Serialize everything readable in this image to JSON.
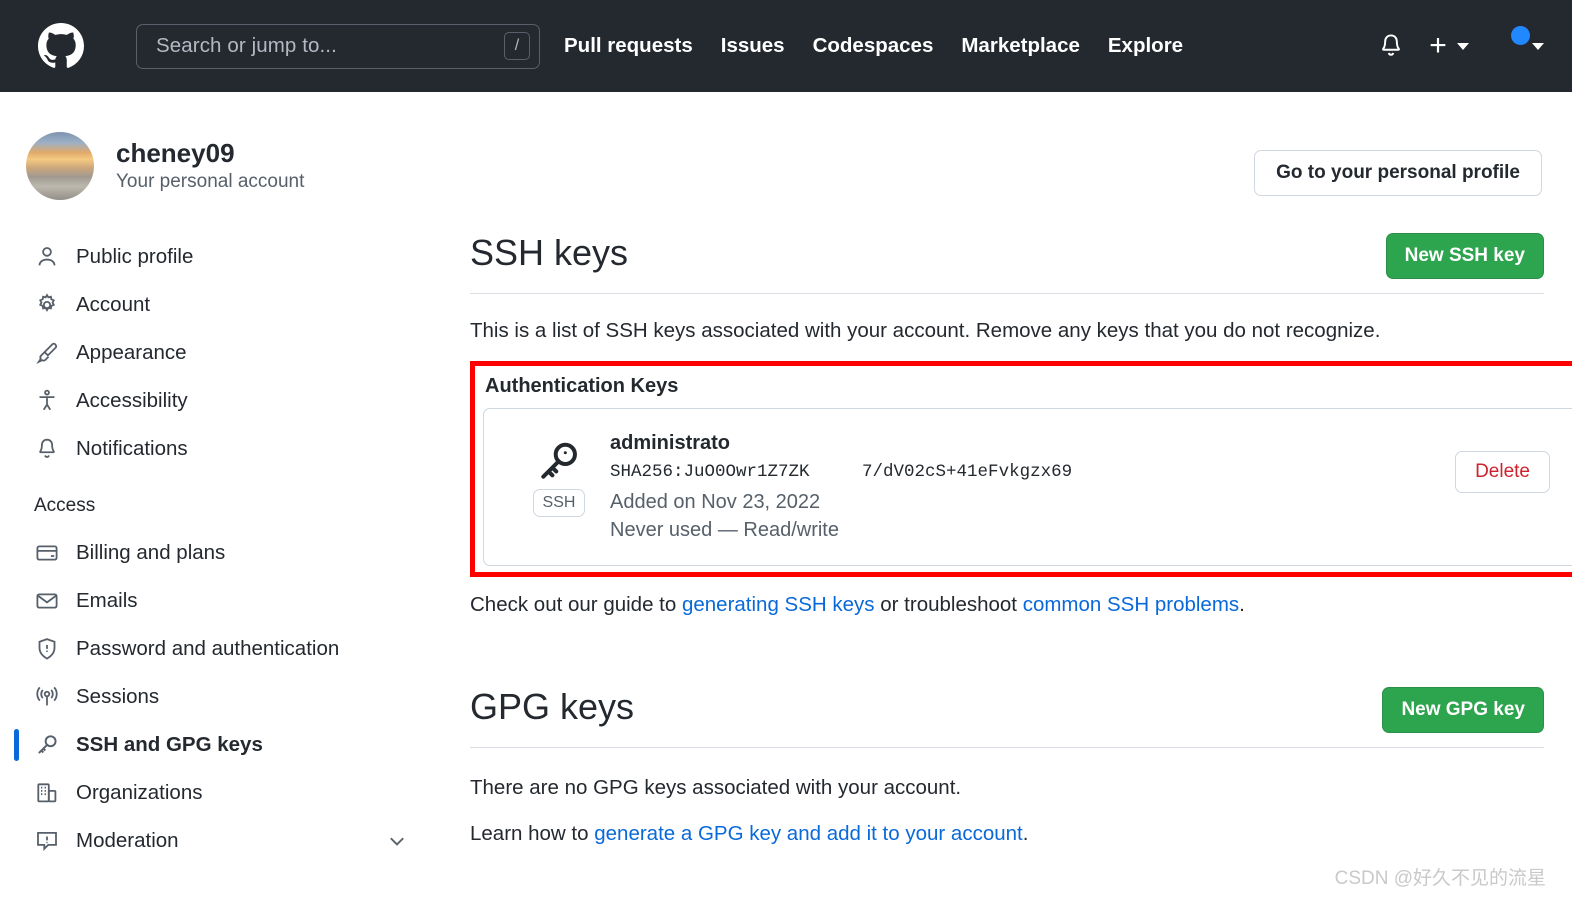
{
  "header": {
    "logo_icon": "github-mark-icon",
    "search": {
      "placeholder": "Search or jump to...",
      "shortcut": "/"
    },
    "nav": [
      {
        "label": "Pull requests"
      },
      {
        "label": "Issues"
      },
      {
        "label": "Codespaces"
      },
      {
        "label": "Marketplace"
      },
      {
        "label": "Explore"
      }
    ],
    "notifications_icon": "bell-icon",
    "create_new_icon": "plus-icon",
    "create_new_caret": "chevron-down-icon",
    "avatar_icon": "user-avatar",
    "avatar_caret": "chevron-down-icon",
    "background_color": "#24292f"
  },
  "profile": {
    "name": "cheney09",
    "subtitle": "Your personal account",
    "go_to_profile_label": "Go to your personal profile"
  },
  "sidebar": {
    "items": [
      {
        "label": "Public profile",
        "icon": "person-icon",
        "active": false
      },
      {
        "label": "Account",
        "icon": "gear-icon",
        "active": false
      },
      {
        "label": "Appearance",
        "icon": "paintbrush-icon",
        "active": false
      },
      {
        "label": "Accessibility",
        "icon": "accessibility-icon",
        "active": false
      },
      {
        "label": "Notifications",
        "icon": "bell-icon",
        "active": false
      }
    ],
    "access_group_title": "Access",
    "access_items": [
      {
        "label": "Billing and plans",
        "icon": "credit-card-icon",
        "active": false
      },
      {
        "label": "Emails",
        "icon": "mail-icon",
        "active": false
      },
      {
        "label": "Password and authentication",
        "icon": "shield-lock-icon",
        "active": false
      },
      {
        "label": "Sessions",
        "icon": "broadcast-icon",
        "active": false
      },
      {
        "label": "SSH and GPG keys",
        "icon": "key-icon",
        "active": true
      },
      {
        "label": "Organizations",
        "icon": "organization-icon",
        "active": false
      },
      {
        "label": "Moderation",
        "icon": "report-icon",
        "active": false,
        "expandable": true
      }
    ]
  },
  "ssh_section": {
    "title": "SSH keys",
    "new_key_button": "New SSH key",
    "description": "This is a list of SSH keys associated with your account. Remove any keys that you do not recognize.",
    "subsection_title": "Authentication Keys",
    "key": {
      "icon": "key-icon",
      "badge": "SSH",
      "title": "administrato",
      "fingerprint": "SHA256:JuO0Owr1Z7ZK     7/dV02cS+41eFvkgzx69",
      "added": "Added on Nov 23, 2022",
      "usage": "Never used — Read/write",
      "delete_label": "Delete"
    },
    "help_prefix": "Check out our guide to ",
    "help_link1": "generating SSH keys",
    "help_middle": " or troubleshoot ",
    "help_link2": "common SSH problems",
    "help_suffix": "."
  },
  "gpg_section": {
    "title": "GPG keys",
    "new_key_button": "New GPG key",
    "description": "There are no GPG keys associated with your account.",
    "learn_prefix": "Learn how to ",
    "learn_link": "generate a GPG key and add it to your account",
    "learn_suffix": "."
  },
  "watermark": "CSDN @好久不见的流星",
  "colors": {
    "header_bg": "#24292f",
    "accent_green": "#2da44e",
    "link_blue": "#0969da",
    "danger_red": "#cf222e",
    "highlight_red": "#fe0000",
    "active_indicator": "#0969da"
  }
}
